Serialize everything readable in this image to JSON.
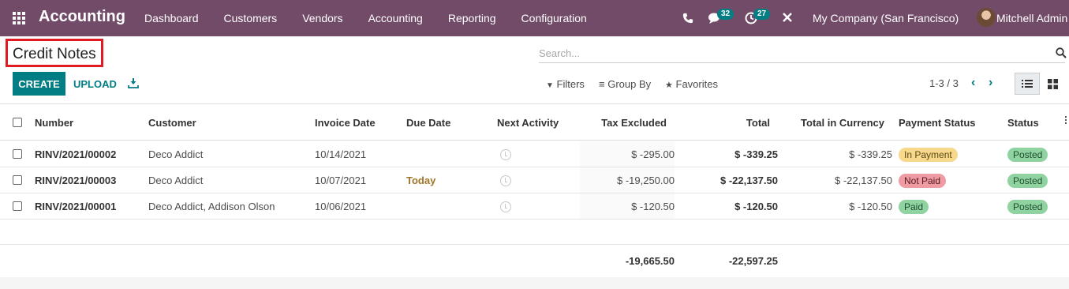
{
  "navbar": {
    "brand": "Accounting",
    "menu": [
      "Dashboard",
      "Customers",
      "Vendors",
      "Accounting",
      "Reporting",
      "Configuration"
    ],
    "chat_count": "32",
    "activity_count": "27",
    "company": "My Company (San Francisco)",
    "user": "Mitchell Admin",
    "icons": [
      "apps-icon",
      "phone-icon",
      "chat-icon",
      "activity-icon",
      "close-icon"
    ],
    "bg_color": "#714b67"
  },
  "control": {
    "title": "Credit Notes",
    "search_placeholder": "Search...",
    "create_label": "CREATE",
    "upload_label": "UPLOAD",
    "filters_label": "Filters",
    "groupby_label": "Group By",
    "favorites_label": "Favorites",
    "pager": "1-3 / 3",
    "accent_color": "#017e84"
  },
  "table": {
    "headers": {
      "number": "Number",
      "customer": "Customer",
      "invoice_date": "Invoice Date",
      "due_date": "Due Date",
      "next_activity": "Next Activity",
      "tax_excluded": "Tax Excluded",
      "total": "Total",
      "total_currency": "Total in Currency",
      "payment_status": "Payment Status",
      "status": "Status"
    },
    "rows": [
      {
        "number": "RINV/2021/00002",
        "customer": "Deco Addict",
        "invoice_date": "10/14/2021",
        "due_date": "",
        "tax_excluded": "$ -295.00",
        "total": "$ -339.25",
        "total_currency": "$ -339.25",
        "payment_status": "In Payment",
        "status": "Posted"
      },
      {
        "number": "RINV/2021/00003",
        "customer": "Deco Addict",
        "invoice_date": "10/07/2021",
        "due_date": "Today",
        "tax_excluded": "$ -19,250.00",
        "total": "$ -22,137.50",
        "total_currency": "$ -22,137.50",
        "payment_status": "Not Paid",
        "status": "Posted"
      },
      {
        "number": "RINV/2021/00001",
        "customer": "Deco Addict, Addison Olson",
        "invoice_date": "10/06/2021",
        "due_date": "",
        "tax_excluded": "$ -120.50",
        "total": "$ -120.50",
        "total_currency": "$ -120.50",
        "payment_status": "Paid",
        "status": "Posted"
      }
    ],
    "sum_tax_excluded": "-19,665.50",
    "sum_total": "-22,597.25"
  }
}
